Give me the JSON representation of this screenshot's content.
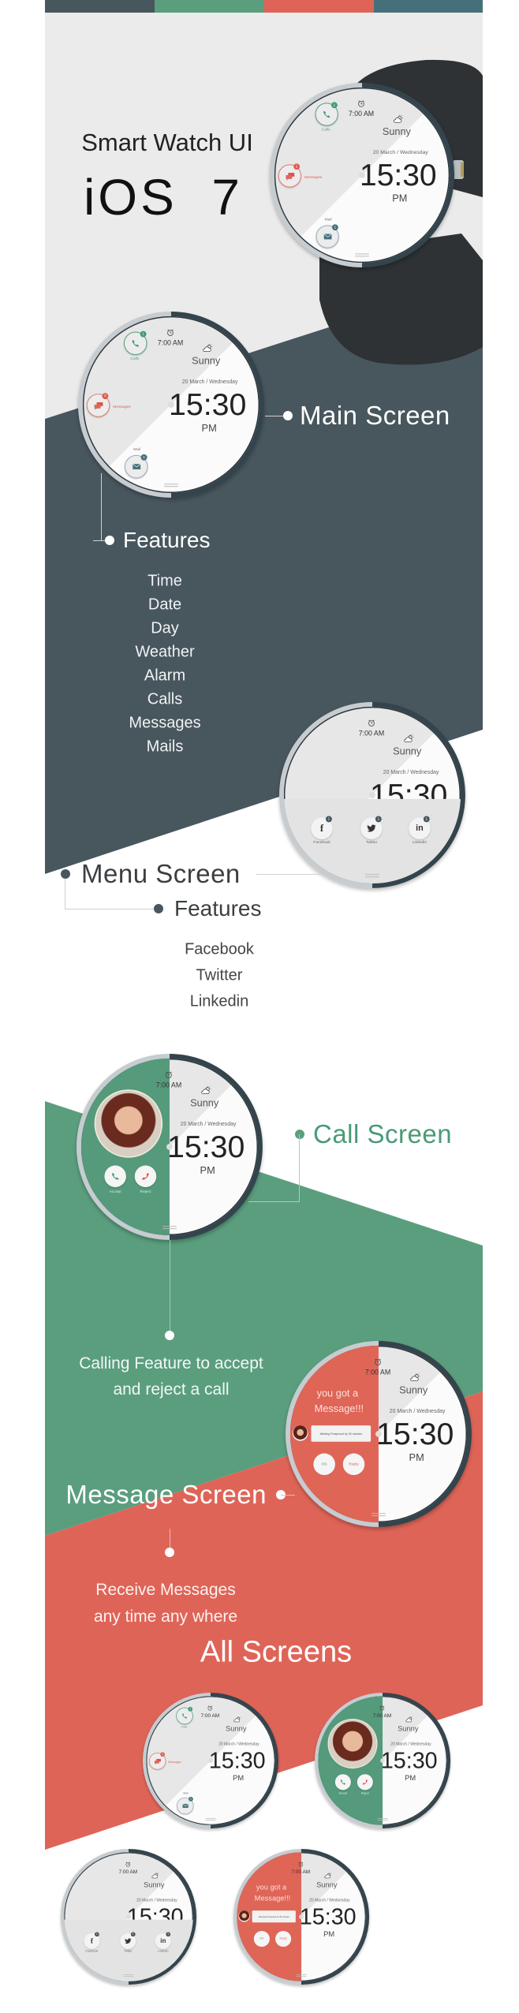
{
  "colors": {
    "slate": "#48565e",
    "green": "#5a9e7e",
    "red": "#df6458",
    "teal": "#467079",
    "light_gray": "#ebebeb"
  },
  "header": {
    "title": "Smart Watch UI",
    "subtitle": "iOS  7"
  },
  "watch": {
    "alarm": "7:00 AM",
    "weather": "Sunny",
    "weather_icon": "cloud-sun-icon",
    "date": "20 March / Wednesday",
    "time": "15:30",
    "ampm": "PM",
    "calls_label": "Calls",
    "calls_badge": "1",
    "messages_label": "Messages",
    "messages_badge": "2",
    "mail_label": "Mail",
    "mail_badge": "1",
    "menu": {
      "facebook": "Facebook",
      "twitter": "Twitter",
      "linkedin": "Linkedin",
      "facebook_badge": "1",
      "twitter_badge": "1",
      "linkedin_badge": "1"
    },
    "call": {
      "accept": "Accept",
      "reject": "Reject"
    },
    "message": {
      "line1": "you got a",
      "line2": "Message!!!",
      "preview": "Meeting Postponed by 30 minutes",
      "ok": "OK",
      "reply": "Reply"
    }
  },
  "main_screen": {
    "title": "Main Screen",
    "features_title": "Features",
    "features": [
      "Time",
      "Date",
      "Day",
      "Weather",
      "Alarm",
      "Calls",
      "Messages",
      "Mails"
    ]
  },
  "menu_screen": {
    "title": "Menu Screen",
    "features_title": "Features",
    "features": [
      "Facebook",
      "Twitter",
      "Linkedin"
    ]
  },
  "call_screen": {
    "title": "Call Screen",
    "description": [
      "Calling Feature to accept",
      "and reject a call"
    ]
  },
  "message_screen": {
    "title": "Message Screen",
    "description": [
      "Receive Messages",
      "any time any where"
    ]
  },
  "all_screens": {
    "title": "All Screens"
  }
}
